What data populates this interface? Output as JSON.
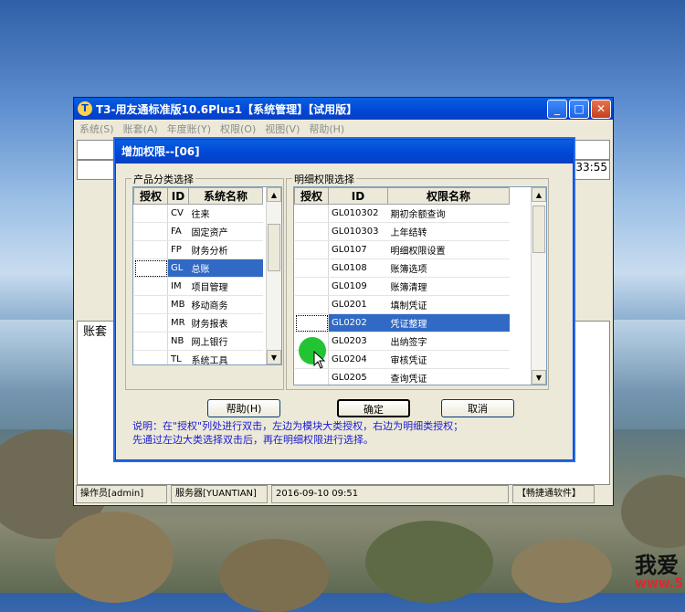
{
  "main_window": {
    "title": "T3-用友通标准版10.6Plus1【系统管理】【试用版】",
    "menu": [
      "系统(S)",
      "账套(A)",
      "年度账(Y)",
      "权限(O)",
      "视图(V)",
      "帮助(H)"
    ],
    "bg_time": "33:55",
    "bg_label": "账套",
    "status": {
      "operator": "操作员[admin]",
      "server": "服务器[YUANTIAN]",
      "datetime": "2016-09-10 09:51",
      "software": "【畅捷通软件】"
    }
  },
  "dialog": {
    "title": "增加权限--[06]",
    "left_group": {
      "label": "产品分类选择",
      "headers": [
        "授权",
        "ID",
        "系统名称"
      ],
      "rows": [
        {
          "id": "CV",
          "name": "往来",
          "selected": false
        },
        {
          "id": "FA",
          "name": "固定资产",
          "selected": false
        },
        {
          "id": "FP",
          "name": "财务分析",
          "selected": false
        },
        {
          "id": "GL",
          "name": "总账",
          "selected": true
        },
        {
          "id": "IM",
          "name": "项目管理",
          "selected": false
        },
        {
          "id": "MB",
          "name": "移动商务",
          "selected": false
        },
        {
          "id": "MR",
          "name": "财务报表",
          "selected": false
        },
        {
          "id": "NB",
          "name": "网上银行",
          "selected": false
        },
        {
          "id": "TL",
          "name": "系统工具",
          "selected": false
        }
      ]
    },
    "right_group": {
      "label": "明细权限选择",
      "headers": [
        "授权",
        "ID",
        "权限名称"
      ],
      "rows": [
        {
          "id": "GL010302",
          "name": "期初余额查询",
          "selected": false
        },
        {
          "id": "GL010303",
          "name": "上年结转",
          "selected": false
        },
        {
          "id": "GL0107",
          "name": "明细权限设置",
          "selected": false
        },
        {
          "id": "GL0108",
          "name": "账簿选项",
          "selected": false
        },
        {
          "id": "GL0109",
          "name": "账簿清理",
          "selected": false
        },
        {
          "id": "GL0201",
          "name": "填制凭证",
          "selected": false
        },
        {
          "id": "GL0202",
          "name": "凭证整理",
          "selected": true
        },
        {
          "id": "GL0203",
          "name": "出纳签字",
          "selected": false
        },
        {
          "id": "GL0204",
          "name": "审核凭证",
          "selected": false
        },
        {
          "id": "GL0205",
          "name": "查询凭证",
          "selected": false
        }
      ]
    },
    "buttons": {
      "help": "帮助(H)",
      "ok": "确定",
      "cancel": "取消"
    },
    "note_line1": "说明：在\"授权\"列处进行双击，左边为模块大类授权，右边为明细类授权；",
    "note_line2": "先通过左边大类选择双击后，再在明细权限进行选择。"
  },
  "watermark": {
    "text": "我爱",
    "url": "www.5"
  }
}
